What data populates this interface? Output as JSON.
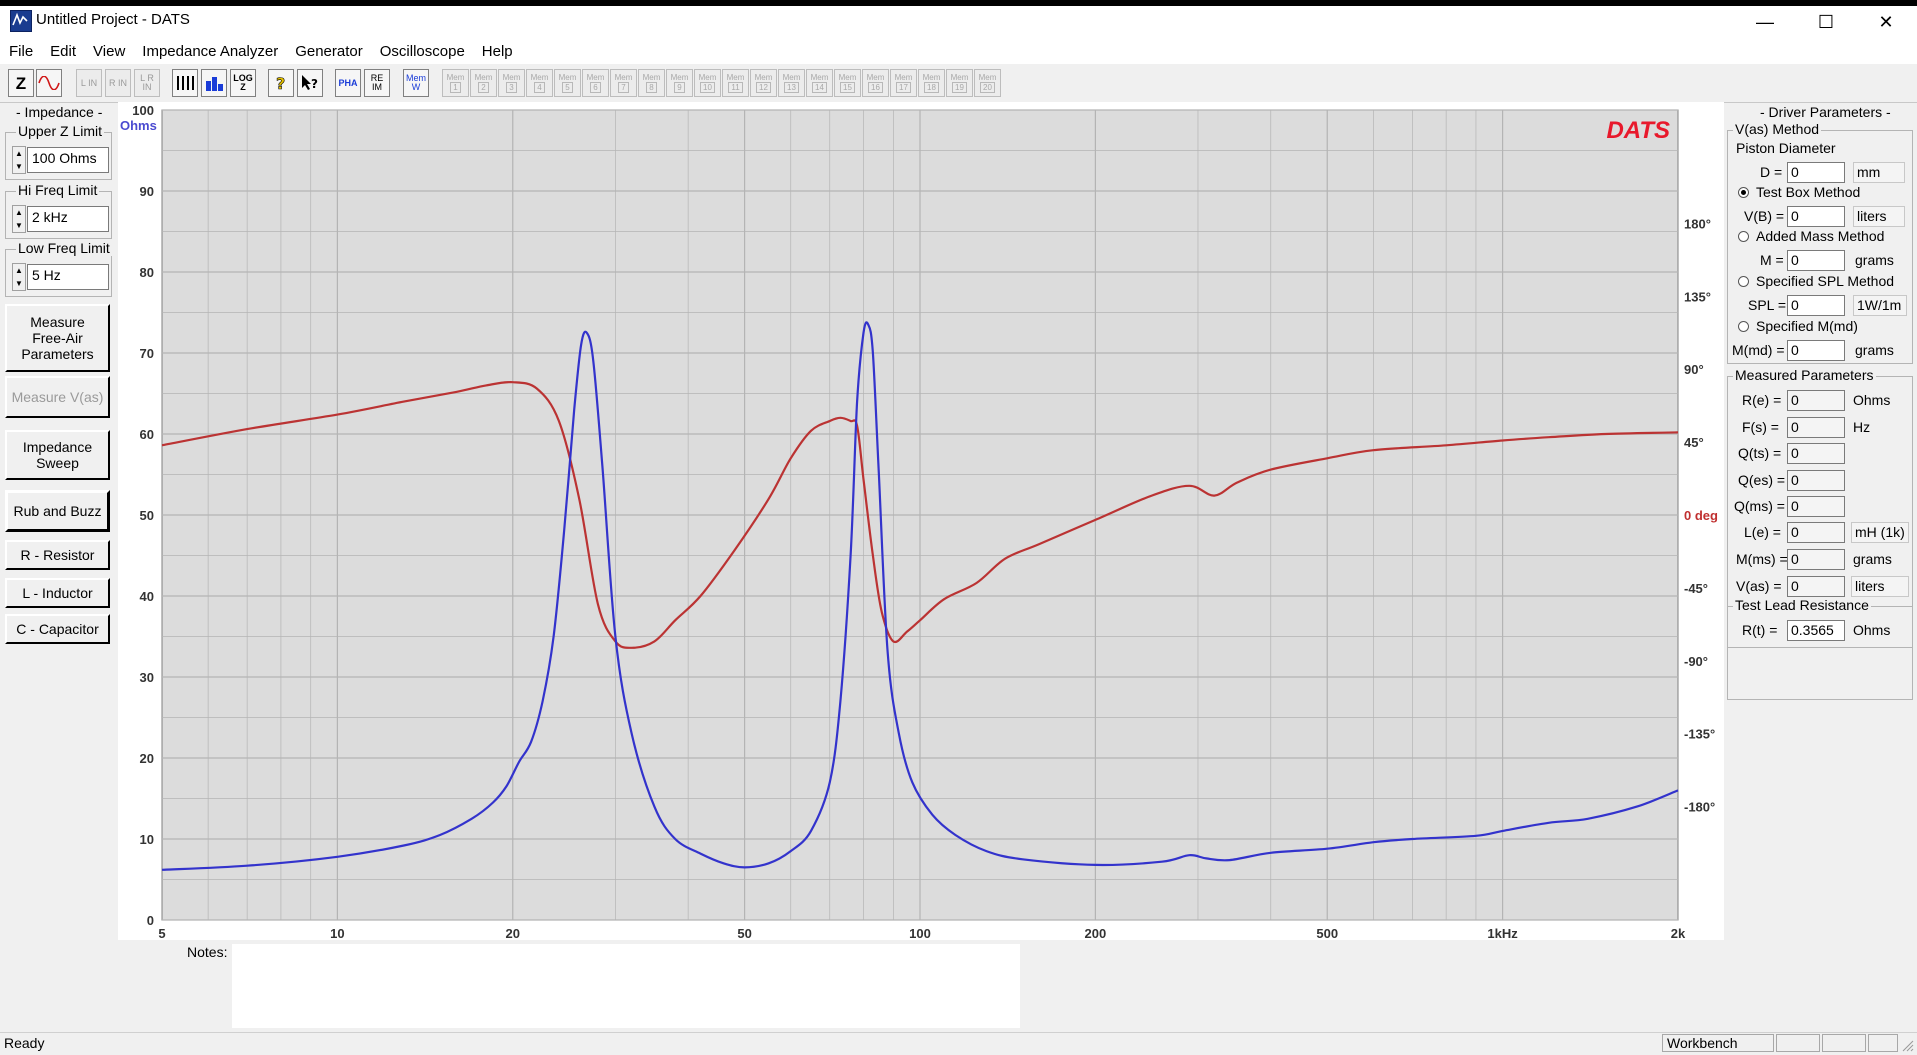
{
  "window": {
    "title": "Untitled Project - DATS",
    "minimize": "—",
    "maximize": "☐",
    "close": "✕"
  },
  "menu": [
    "File",
    "Edit",
    "View",
    "Impedance Analyzer",
    "Generator",
    "Oscilloscope",
    "Help"
  ],
  "toolbar": {
    "z": "Z",
    "l_in": "L IN",
    "r_in": "R IN",
    "lr_in": "L R IN",
    "log_z": "LOG Z",
    "pha": "PHA",
    "re_im": "RE IM",
    "mem_w": "Mem W",
    "mem_slots": [
      "1",
      "2",
      "3",
      "4",
      "5",
      "6",
      "7",
      "8",
      "9",
      "10",
      "11",
      "12",
      "13",
      "14",
      "15",
      "16",
      "17",
      "18",
      "19",
      "20"
    ],
    "mem_label": "Mem"
  },
  "left": {
    "impedance_title": "- Impedance -",
    "upper_z_label": "Upper Z Limit",
    "upper_z_value": "100 Ohms",
    "hi_freq_label": "Hi Freq Limit",
    "hi_freq_value": "2 kHz",
    "low_freq_label": "Low Freq Limit",
    "low_freq_value": "5 Hz",
    "btn_free_air_1": "Measure",
    "btn_free_air_2": "Free-Air",
    "btn_free_air_3": "Parameters",
    "btn_vas": "Measure V(as)",
    "btn_sweep_1": "Impedance",
    "btn_sweep_2": "Sweep",
    "btn_rub": "Rub and Buzz",
    "btn_resistor": "R - Resistor",
    "btn_inductor": "L - Inductor",
    "btn_capacitor": "C - Capacitor"
  },
  "right": {
    "driver_title": "- Driver Parameters -",
    "vas_method": "V(as) Method",
    "piston_diameter": "Piston Diameter",
    "d_label": "D =",
    "d_value": "0",
    "d_unit": "mm",
    "test_box": "Test Box Method",
    "vb_label": "V(B) =",
    "vb_value": "0",
    "vb_unit": "liters",
    "added_mass": "Added Mass Method",
    "m_label": "M =",
    "m_value": "0",
    "m_unit": "grams",
    "spl_method": "Specified SPL Method",
    "spl_label": "SPL =",
    "spl_value": "0",
    "spl_unit": "1W/1m",
    "mmd_method": "Specified M(md)",
    "mmd_label": "M(md) =",
    "mmd_value": "0",
    "mmd_unit": "grams",
    "measured_title": "Measured Parameters",
    "measured": [
      {
        "label": "R(e) =",
        "value": "0",
        "unit": "Ohms"
      },
      {
        "label": "F(s) =",
        "value": "0",
        "unit": "Hz"
      },
      {
        "label": "Q(ts) =",
        "value": "0",
        "unit": ""
      },
      {
        "label": "Q(es) =",
        "value": "0",
        "unit": ""
      },
      {
        "label": "Q(ms) =",
        "value": "0",
        "unit": ""
      },
      {
        "label": "L(e) =",
        "value": "0",
        "unit": "mH (1k)"
      },
      {
        "label": "M(ms) =",
        "value": "0",
        "unit": "grams"
      },
      {
        "label": "V(as) =",
        "value": "0",
        "unit": "liters"
      }
    ],
    "lead_title": "Test Lead Resistance",
    "rt_label": "R(t) =",
    "rt_value": "0.3565",
    "rt_unit": "Ohms"
  },
  "notes_label": "Notes:",
  "status": {
    "left": "Ready",
    "right": "Workbench"
  },
  "colors": {
    "impedance": "#3333cc",
    "phase": "#bb3333",
    "brand": "#e8192c",
    "grid": "#b4b4b4",
    "plot_bg": "#dcdcdc"
  },
  "chart_data": {
    "type": "line",
    "brand": "DATS",
    "x_scale": "log",
    "xlim": [
      5,
      2000
    ],
    "x_ticks": [
      5,
      10,
      20,
      50,
      100,
      200,
      500,
      1000,
      2000
    ],
    "x_tick_labels": [
      "5",
      "10",
      "20",
      "50",
      "100",
      "200",
      "500",
      "1kHz",
      "2k"
    ],
    "ylim_left": [
      0,
      100
    ],
    "y_left_unit": "Ohms",
    "y_left_ticks": [
      0,
      10,
      20,
      30,
      40,
      50,
      60,
      70,
      80,
      90,
      100
    ],
    "ylim_right": [
      -250,
      250
    ],
    "y_right_ticks": [
      -180,
      -135,
      -90,
      -45,
      0,
      45,
      90,
      135,
      180
    ],
    "y_right_tick_labels": [
      "-180°",
      "-135°",
      "-90°",
      "-45°",
      "0 deg",
      "45°",
      "90°",
      "135°",
      "180°"
    ],
    "grid": true,
    "series": [
      {
        "axis": "left",
        "x": [
          5,
          7,
          10,
          13,
          15,
          17,
          18.5,
          19.5,
          20.5,
          21.5,
          22.5,
          23.5,
          24.5,
          25.5,
          26.2,
          26.8,
          27.5,
          28.5,
          30,
          32,
          35,
          38,
          42,
          46,
          50,
          55,
          60,
          65,
          70,
          73,
          76,
          78,
          80,
          81.5,
          83,
          85,
          88,
          92,
          97,
          105,
          115,
          130,
          150,
          200,
          260,
          290,
          310,
          340,
          400,
          500,
          600,
          700,
          900,
          1000,
          1200,
          1400,
          1700,
          2000
        ],
        "y": [
          6.2,
          6.7,
          7.8,
          9.2,
          10.5,
          12.5,
          14.5,
          16.5,
          19.5,
          22,
          27,
          35,
          48,
          63,
          71,
          72.5,
          69,
          56,
          35,
          23,
          14,
          10,
          8.2,
          7,
          6.5,
          7,
          8.5,
          11,
          17,
          27,
          45,
          64,
          72.5,
          73.5,
          70,
          55,
          33,
          23,
          17,
          13,
          10.5,
          8.5,
          7.5,
          6.8,
          7.2,
          8,
          7.6,
          7.4,
          8.3,
          8.8,
          9.6,
          10,
          10.4,
          11,
          12,
          12.5,
          14,
          16
        ]
      },
      {
        "axis": "right",
        "x": [
          5,
          7,
          10,
          13,
          16,
          18,
          20,
          22,
          24,
          26,
          28,
          30,
          32,
          35,
          38,
          42,
          48,
          55,
          60,
          65,
          70,
          73,
          76,
          78,
          80,
          83,
          86,
          90,
          95,
          100,
          110,
          125,
          140,
          160,
          200,
          250,
          290,
          320,
          350,
          400,
          500,
          600,
          800,
          1000,
          1200,
          1500,
          2000
        ],
        "y": [
          43,
          53,
          62,
          70,
          76,
          80,
          82,
          78,
          58,
          10,
          -55,
          -78,
          -82,
          -78,
          -65,
          -50,
          -22,
          10,
          35,
          52,
          58,
          60,
          58,
          55,
          22,
          -25,
          -60,
          -78,
          -72,
          -65,
          -52,
          -42,
          -27,
          -18,
          -3,
          12,
          18,
          12,
          20,
          28,
          35,
          40,
          43,
          46,
          48,
          50,
          51
        ]
      }
    ]
  }
}
